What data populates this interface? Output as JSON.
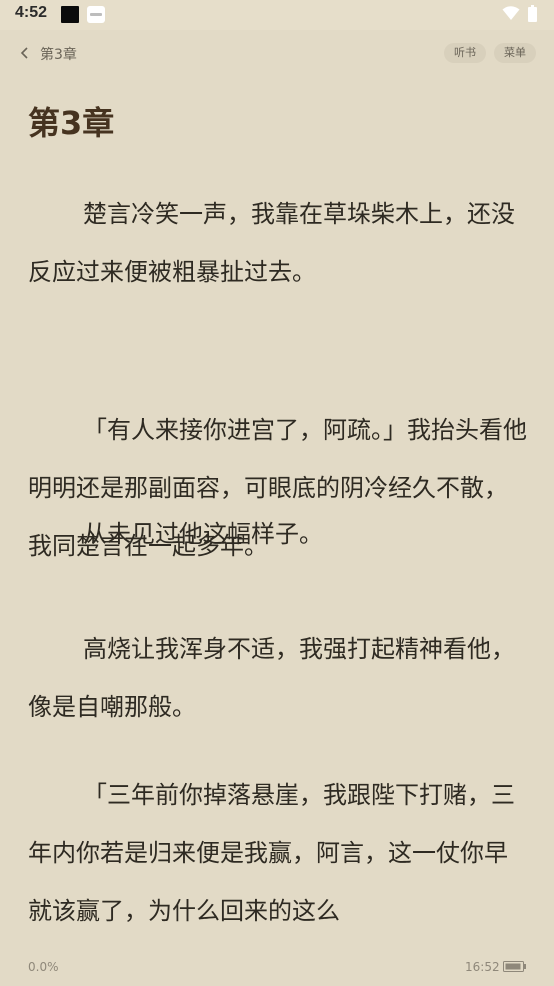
{
  "status_bar": {
    "time": "4:52"
  },
  "top_bar": {
    "chapter_title": "第3章",
    "listen_label": "听书",
    "menu_label": "菜单"
  },
  "chapter": {
    "heading": "第3章",
    "paragraphs": [
      "楚言冷笑一声，我靠在草垛柴木上，还没反应过来便被粗暴扯过去。",
      "「有人来接你进宫了，阿疏。」我抬头看他明明还是那副面容，可眼底的阴冷经久不散，我同楚言在一起多年。",
      "从未见过他这幅样子。",
      "高烧让我浑身不适，我强打起精神看他，像是自嘲那般。",
      "「三年前你掉落悬崖，我跟陛下打赌，三年内你若是归来便是我赢，阿言，这一仗你早就该赢了，为什么回来的这么"
    ]
  },
  "footer": {
    "progress": "0.0%",
    "time": "16:52"
  }
}
